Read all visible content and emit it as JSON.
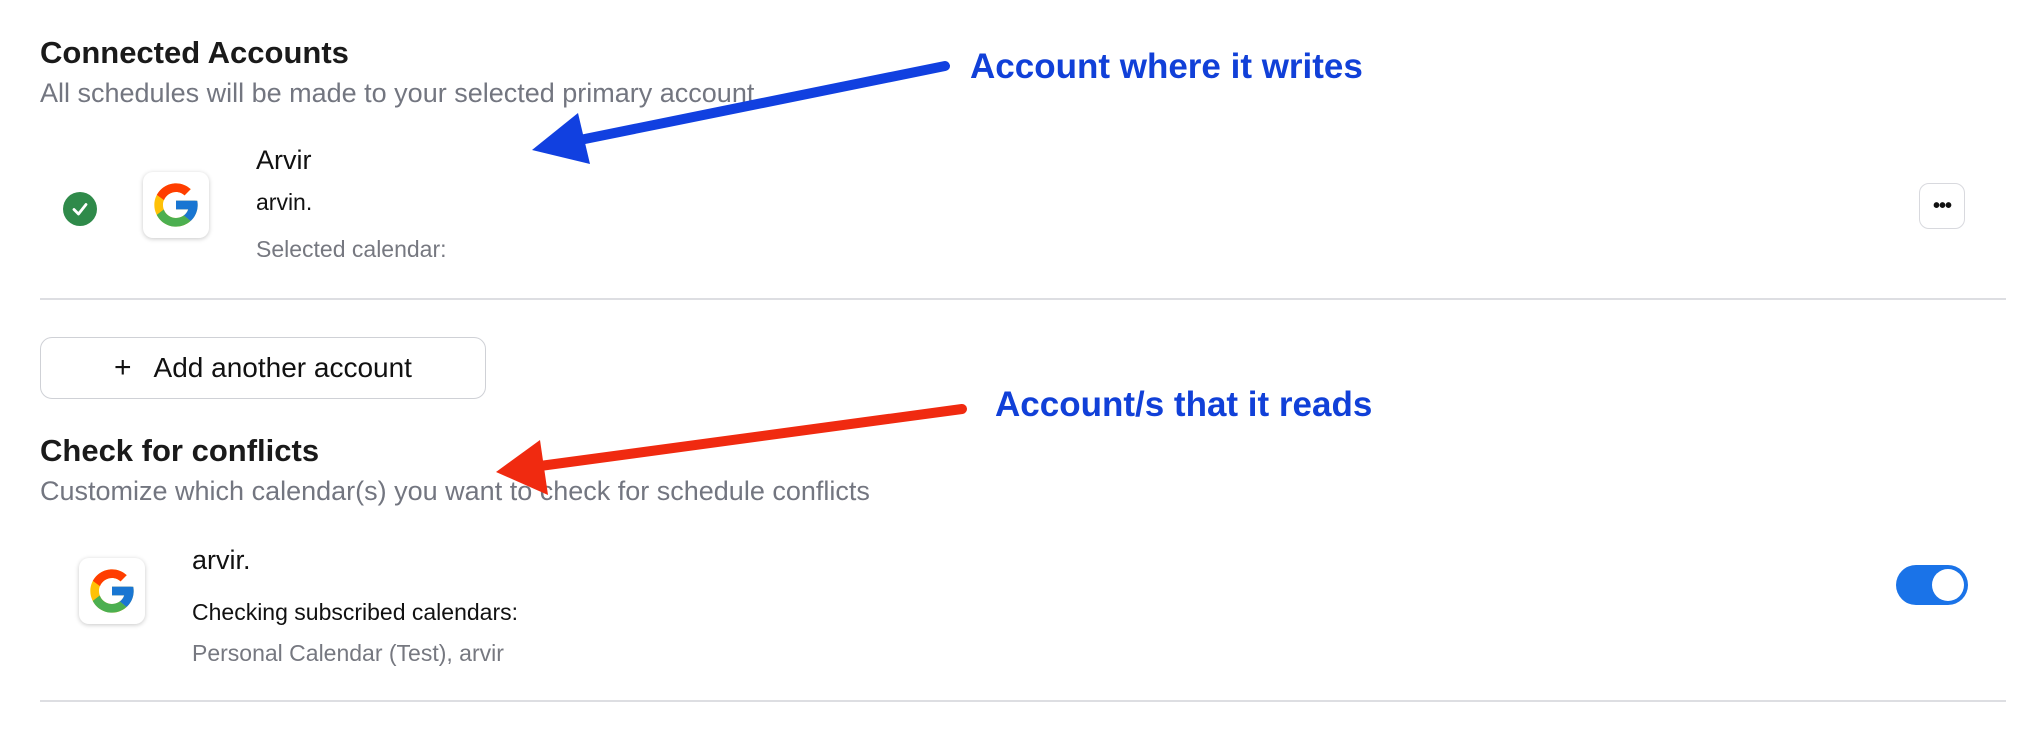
{
  "connected_accounts": {
    "title": "Connected Accounts",
    "subtitle": "All schedules will be made to your selected primary account",
    "account": {
      "name": "Arvir",
      "email": "arvin.",
      "selected_calendar_label": "Selected calendar:",
      "selected_calendar_value": "",
      "status_color": "#2f8a4a",
      "icon": "google-icon",
      "more_label": "•••"
    },
    "add_account": {
      "plus": "+",
      "label": "Add another account"
    }
  },
  "conflicts": {
    "title": "Check for conflicts",
    "subtitle": "Customize which calendar(s) you want to check for schedule conflicts",
    "account": {
      "email": "arvir.",
      "checking_label": "Checking subscribed calendars:",
      "calendars": "Personal Calendar (Test), arvir",
      "icon": "google-icon",
      "toggle_on": true,
      "toggle_color": "#1a73e8"
    }
  },
  "annotations": {
    "writes": {
      "text": "Account where it writes",
      "color": "#1140d8",
      "arrow_color": "#1140e0"
    },
    "reads": {
      "text": "Account/s that it reads",
      "color": "#1140d8",
      "arrow_color": "#f02a10"
    }
  }
}
